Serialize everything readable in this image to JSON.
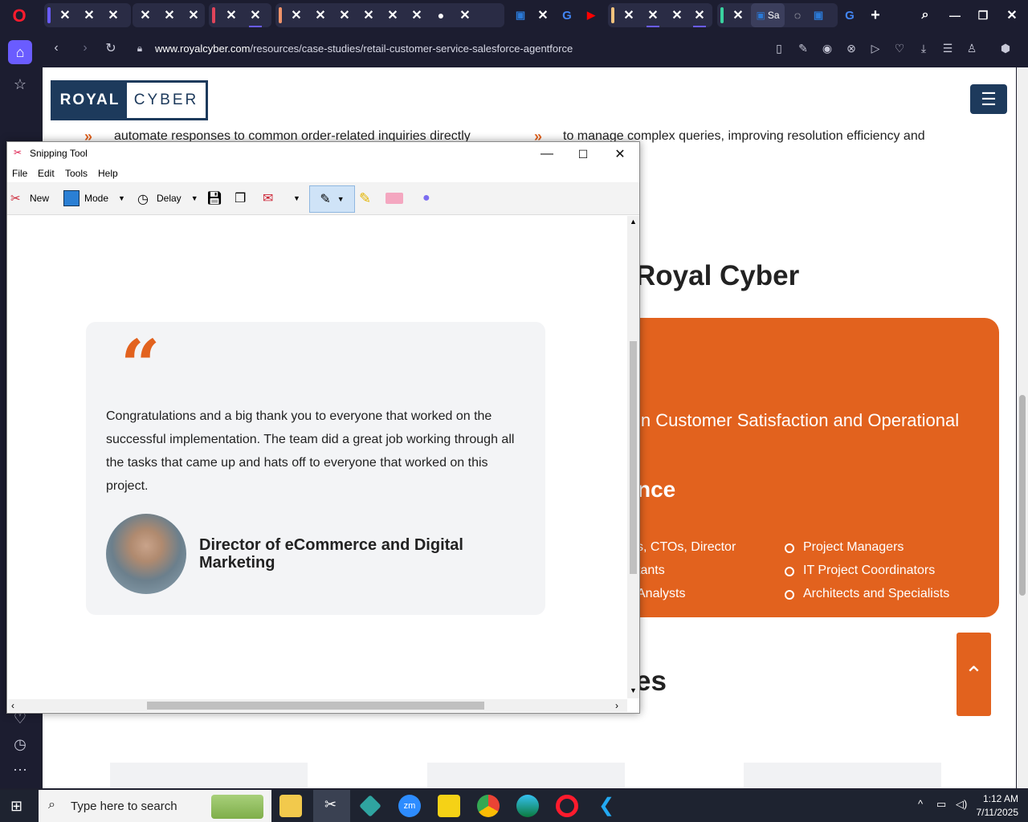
{
  "browser": {
    "url_domain": "www.royalcyber.com",
    "url_path": "/resources/case-studies/retail-customer-service-salesforce-agentforce",
    "partial_tab_label": "Sa"
  },
  "page": {
    "logo_left": "ROYAL",
    "logo_right": "CYBER",
    "line1": "automate responses to common order-related inquiries directly",
    "line2": "to manage complex queries, improving resolution efficiency and",
    "heading": "Royal Cyber",
    "orange_subtitle": "in Customer Satisfaction and Operational",
    "orange_title": "nce",
    "list_left": [
      "s, CTOs, Director",
      "tants",
      "Analysts"
    ],
    "list_right": [
      "Project Managers",
      "IT Project Coordinators",
      "Architects and Specialists"
    ],
    "heading2": "es"
  },
  "snipping_tool": {
    "title": "Snipping Tool",
    "menu": [
      "File",
      "Edit",
      "Tools",
      "Help"
    ],
    "toolbar": {
      "new": "New",
      "mode": "Mode",
      "delay": "Delay"
    },
    "quote_text": "Congratulations and a big thank you to everyone that worked on the successful implementation. The team did a great job working through all the tasks that came up and hats off to everyone that worked on this project.",
    "quote_author": "Director of eCommerce and Digital Marketing"
  },
  "taskbar": {
    "search_placeholder": "Type here to search",
    "time": "1:12 AM",
    "date": "7/11/2025"
  },
  "colors": {
    "accent": "#e2621e",
    "brand": "#1d3a5c"
  }
}
